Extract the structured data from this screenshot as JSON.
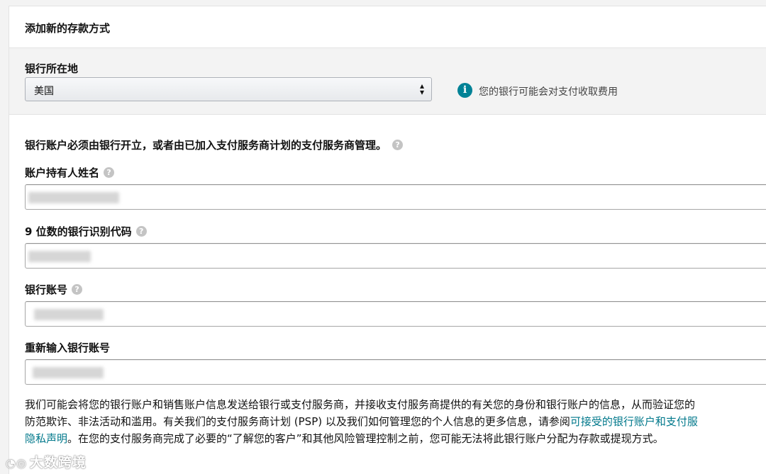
{
  "section": {
    "title": "添加新的存款方式"
  },
  "location": {
    "label": "银行所在地",
    "selected": "美国",
    "info_icon": "info-icon",
    "info_text": "您的银行可能会对支付收取费用"
  },
  "notice": "银行账户必须由银行开立，或者由已加入支付服务商计划的支付服务商管理。",
  "fields": {
    "holder": {
      "label": "账户持有人姓名"
    },
    "routing": {
      "label": "9 位数的银行识别代码"
    },
    "account": {
      "label": "银行账号"
    },
    "reenter": {
      "label": "重新输入银行账号"
    }
  },
  "disclaimer": {
    "line1": "我们可能会将您的银行账户和销售账户信息发送给银行或支付服务商，并接收支付服务商提供的有关您的身份和银行账户的信息，从而验证您的",
    "line2_a": "防范欺诈、非法活动和滥用。有关我们的支付服务商计划 (PSP) 以及我们如何管理您的个人信息的更多信息，请参阅",
    "line2_link": "可接受的银行账户和支付服",
    "line3_link": "隐私声明",
    "line3_b": "。在您的支付服务商完成了必要的“了解您的客户”和其他风险管理控制之前，您可能无法将此银行账户分配为存款或提现方式。"
  },
  "watermark": {
    "text": "大数跨境"
  },
  "colors": {
    "accent": "#008296",
    "link": "#00788b"
  }
}
